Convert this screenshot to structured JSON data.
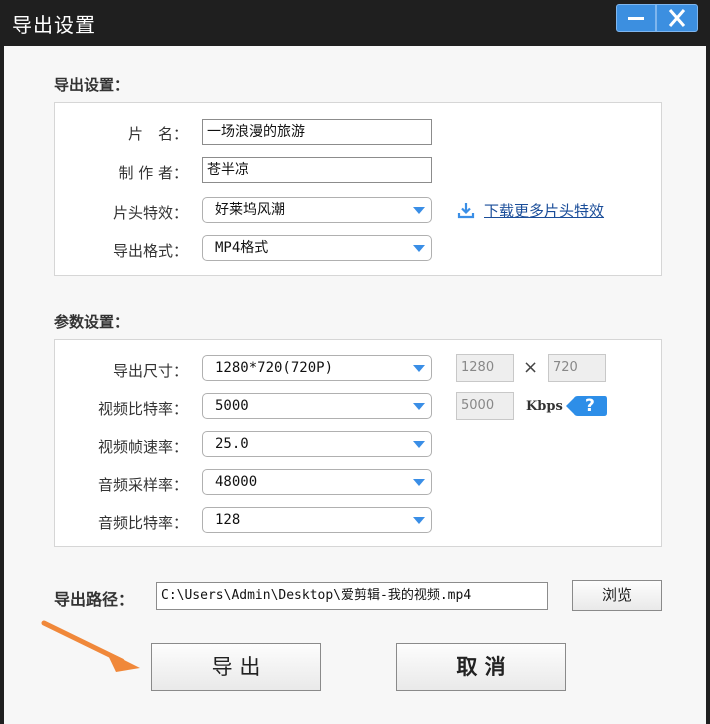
{
  "window": {
    "title": "导出设置"
  },
  "export_settings": {
    "section_title": "导出设置：",
    "title_label": "片　名：",
    "title_value": "一场浪漫的旅游",
    "author_label": "制 作 者：",
    "author_value": "苍半凉",
    "intro_label": "片头特效：",
    "intro_value": "好莱坞风潮",
    "download_link": "下载更多片头特效",
    "format_label": "导出格式：",
    "format_value": "MP4格式"
  },
  "params": {
    "section_title": "参数设置：",
    "size_label": "导出尺寸：",
    "size_value": "1280*720(720P)",
    "width_value": "1280",
    "times": "×",
    "height_value": "720",
    "vbitrate_label": "视频比特率：",
    "vbitrate_value": "5000",
    "vbitrate_box": "5000",
    "kbps": "Kbps",
    "help": "?",
    "fps_label": "视频帧速率：",
    "fps_value": "25.0",
    "samplerate_label": "音频采样率：",
    "samplerate_value": "48000",
    "abitrate_label": "音频比特率：",
    "abitrate_value": "128"
  },
  "path": {
    "label": "导出路径：",
    "value": "C:\\Users\\Admin\\Desktop\\爱剪辑-我的视频.mp4",
    "browse": "浏览"
  },
  "actions": {
    "export": "导 出",
    "cancel": "取 消"
  },
  "colors": {
    "accent": "#3c8fe0",
    "arrow": "#f0883a"
  }
}
